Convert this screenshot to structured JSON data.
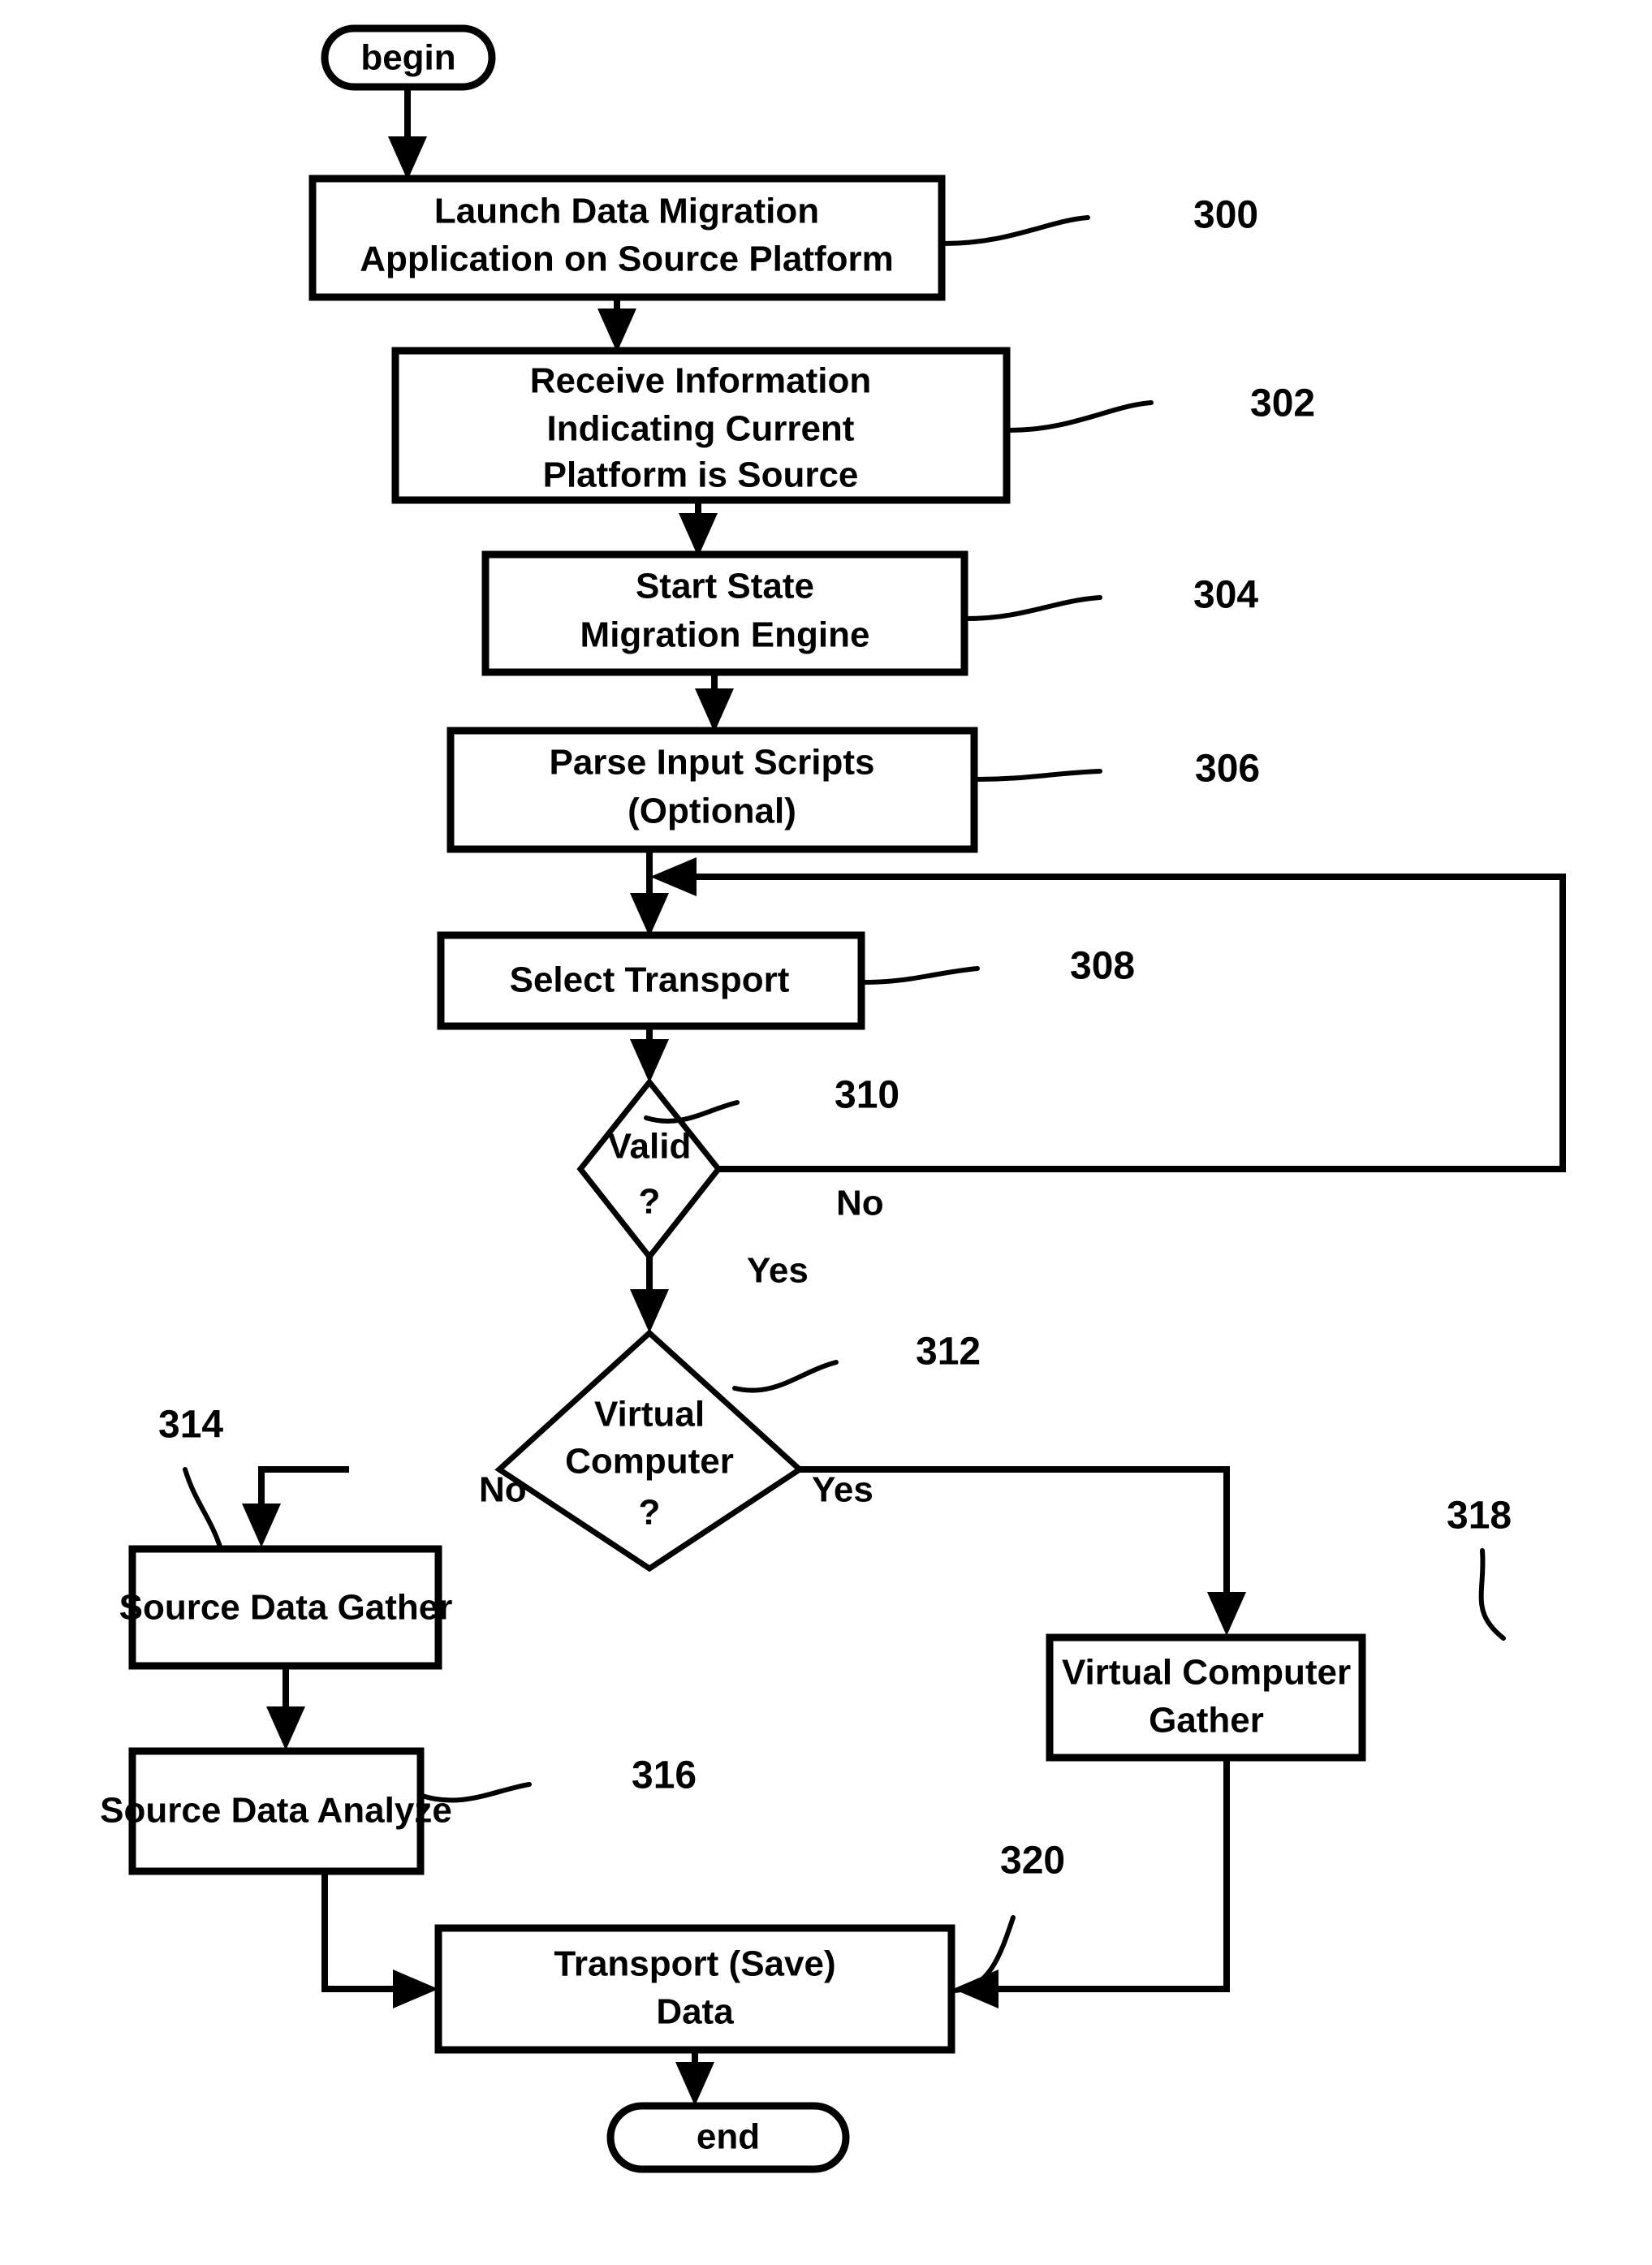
{
  "figure": {
    "type": "flowchart",
    "orientation": "top-to-bottom",
    "background_color": "#ffffff",
    "line_color": "#000000"
  },
  "nodes": {
    "begin": {
      "label": "begin",
      "shape": "terminator"
    },
    "n300": {
      "line1": "Launch Data Migration",
      "line2": "Application on Source Platform",
      "shape": "process",
      "ref": "300"
    },
    "n302": {
      "line1": "Receive Information",
      "line2": "Indicating Current",
      "line3": "Platform is Source",
      "shape": "process",
      "ref": "302"
    },
    "n304": {
      "line1": "Start State",
      "line2": "Migration Engine",
      "shape": "process",
      "ref": "304"
    },
    "n306": {
      "line1": "Parse Input Scripts",
      "line2": "(Optional)",
      "shape": "process",
      "ref": "306"
    },
    "n308": {
      "line1": "Select Transport",
      "shape": "process",
      "ref": "308"
    },
    "n310": {
      "line1": "Valid",
      "line2": "?",
      "shape": "decision",
      "ref": "310"
    },
    "n312": {
      "line1": "Virtual",
      "line2": "Computer",
      "line3": "?",
      "shape": "decision",
      "ref": "312"
    },
    "n314": {
      "line1": "Source Data Gather",
      "shape": "process",
      "ref": "314"
    },
    "n316": {
      "line1": "Source Data Analyze",
      "shape": "process",
      "ref": "316"
    },
    "n318": {
      "line1": "Virtual Computer",
      "line2": "Gather",
      "shape": "process",
      "ref": "318"
    },
    "n320": {
      "line1": "Transport (Save)",
      "line2": "Data",
      "shape": "process",
      "ref": "320"
    },
    "end": {
      "label": "end",
      "shape": "terminator"
    }
  },
  "edge_labels": {
    "valid_no": "No",
    "valid_yes": "Yes",
    "virtual_no": "No",
    "virtual_yes": "Yes"
  },
  "edges": [
    {
      "from": "begin",
      "to": "n300",
      "label": ""
    },
    {
      "from": "n300",
      "to": "n302",
      "label": ""
    },
    {
      "from": "n302",
      "to": "n304",
      "label": ""
    },
    {
      "from": "n304",
      "to": "n306",
      "label": ""
    },
    {
      "from": "n306",
      "to": "n308",
      "label": ""
    },
    {
      "from": "n308",
      "to": "n310",
      "label": ""
    },
    {
      "from": "n310",
      "to": "n308",
      "label": "No"
    },
    {
      "from": "n310",
      "to": "n312",
      "label": "Yes"
    },
    {
      "from": "n312",
      "to": "n314",
      "label": "No"
    },
    {
      "from": "n312",
      "to": "n318",
      "label": "Yes"
    },
    {
      "from": "n314",
      "to": "n316",
      "label": ""
    },
    {
      "from": "n316",
      "to": "n320",
      "label": ""
    },
    {
      "from": "n318",
      "to": "n320",
      "label": ""
    },
    {
      "from": "n320",
      "to": "end",
      "label": ""
    }
  ]
}
